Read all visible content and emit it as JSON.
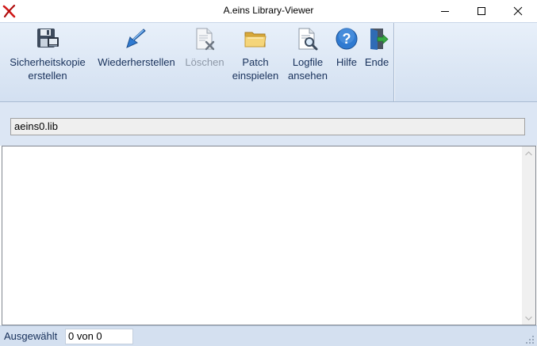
{
  "window": {
    "title": "A.eins Library-Viewer",
    "icon": "red-x-app-icon",
    "controls": [
      "minimize-icon",
      "maximize-icon",
      "close-icon"
    ]
  },
  "toolbar": {
    "buttons": [
      {
        "id": "backup",
        "label": "Sicherheitskopie\nerstellen",
        "icon": "floppy-disk-icon",
        "enabled": true
      },
      {
        "id": "restore",
        "label": "Wiederherstellen",
        "icon": "blue-arrow-icon",
        "enabled": true
      },
      {
        "id": "delete",
        "label": "Löschen",
        "icon": "delete-document-icon",
        "enabled": false
      },
      {
        "id": "patch",
        "label": "Patch\neinspielen",
        "icon": "folder-icon",
        "enabled": true
      },
      {
        "id": "logfile",
        "label": "Logfile\nansehen",
        "icon": "magnifier-document-icon",
        "enabled": true
      },
      {
        "id": "help",
        "label": "Hilfe",
        "icon": "help-icon",
        "enabled": true
      },
      {
        "id": "exit",
        "label": "Ende",
        "icon": "exit-door-icon",
        "enabled": true
      }
    ]
  },
  "path": {
    "value": "aeins0.lib"
  },
  "list": {
    "items": []
  },
  "status": {
    "label": "Ausgewählt",
    "value": "0 von 0"
  },
  "colors": {
    "toolbar_bg": "#dbe6f4",
    "label_text": "#17305a",
    "disabled_text": "#8f99a8",
    "accent_blue": "#2f7ad1"
  }
}
